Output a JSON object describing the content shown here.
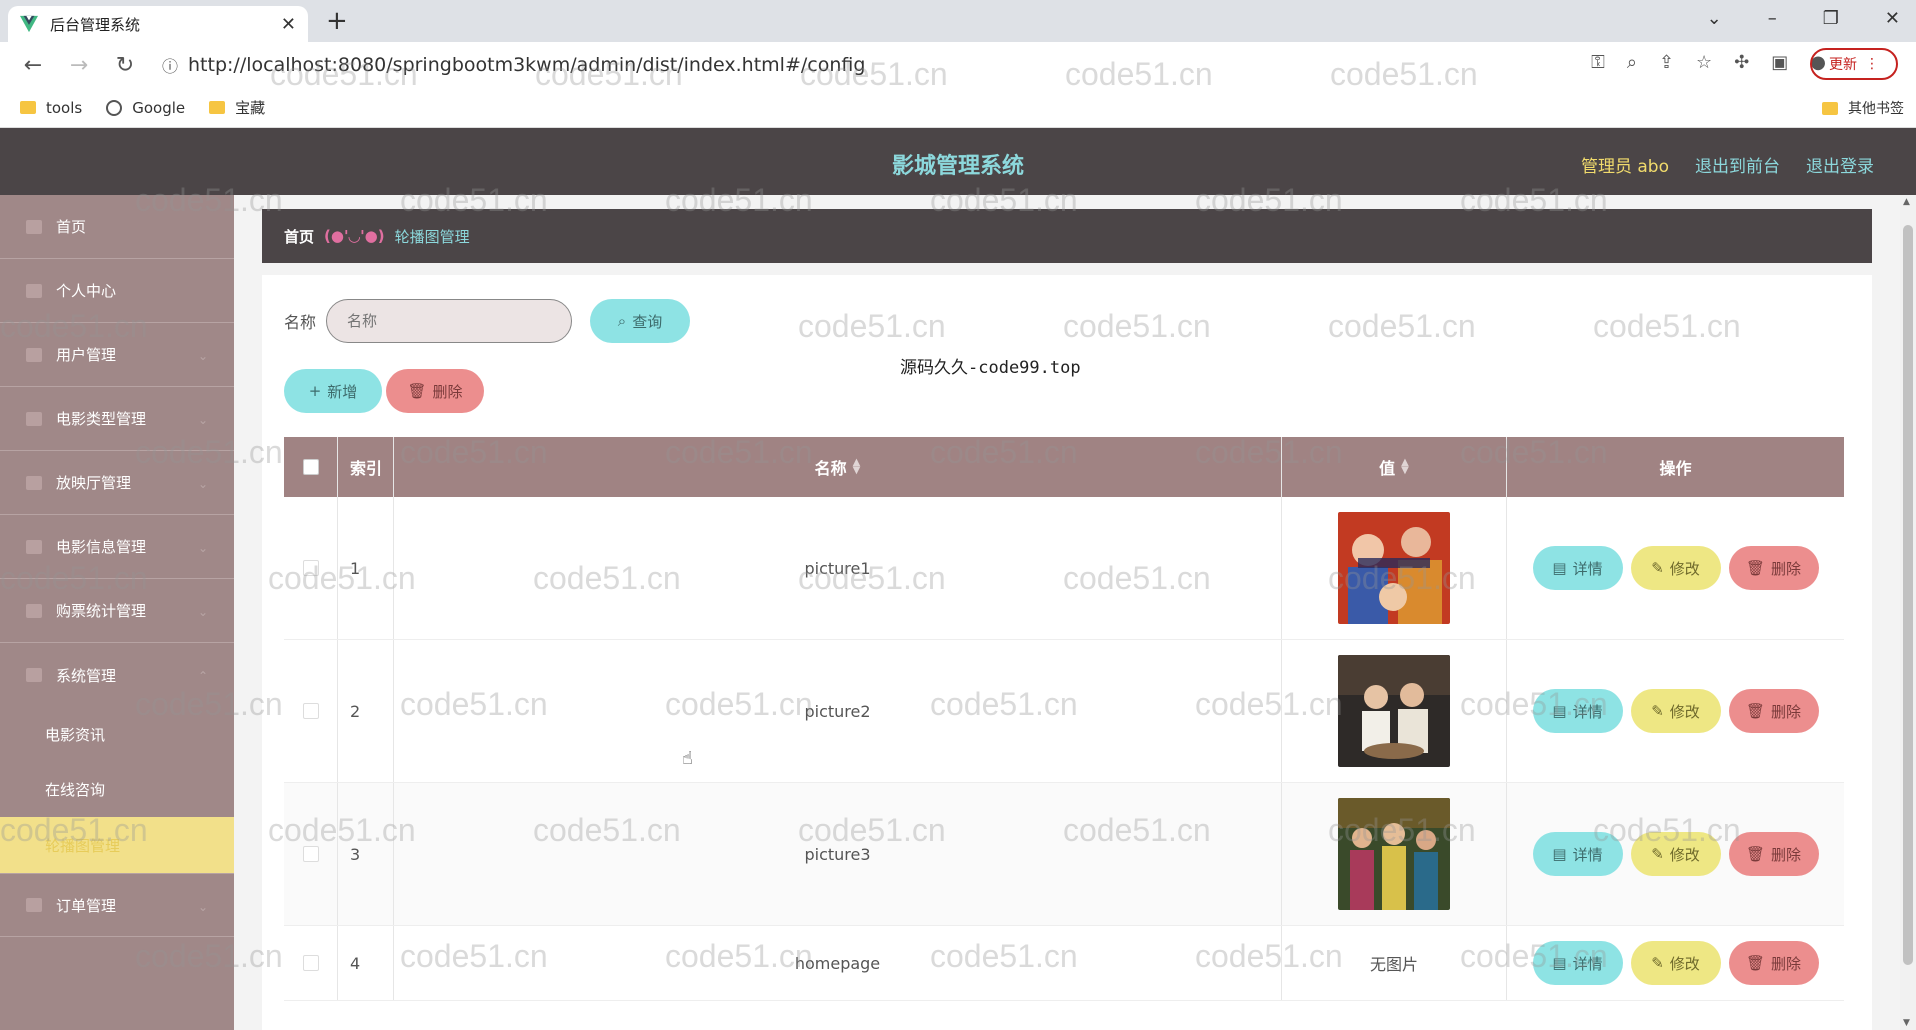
{
  "browser": {
    "tab_title": "后台管理系统",
    "url": "http://localhost:8080/springbootm3kwm/admin/dist/index.html#/config",
    "update_label": "更新",
    "bookmarks": [
      "tools",
      "Google",
      "宝藏"
    ],
    "other_bookmarks": "其他书签"
  },
  "header": {
    "title": "影城管理系统",
    "admin": "管理员 abo",
    "front": "退出到前台",
    "logout": "退出登录"
  },
  "sidebar": {
    "items": [
      {
        "label": "首页"
      },
      {
        "label": "个人中心"
      },
      {
        "label": "用户管理"
      },
      {
        "label": "电影类型管理"
      },
      {
        "label": "放映厅管理"
      },
      {
        "label": "电影信息管理"
      },
      {
        "label": "购票统计管理"
      },
      {
        "label": "系统管理"
      }
    ],
    "sub_items": [
      {
        "label": "电影资讯"
      },
      {
        "label": "在线咨询"
      },
      {
        "label": "轮播图管理"
      }
    ],
    "last": "订单管理"
  },
  "breadcrumb": {
    "home": "首页",
    "face": "(●'◡'●)",
    "current": "轮播图管理"
  },
  "search": {
    "label": "名称",
    "placeholder": "名称",
    "query_label": "查询"
  },
  "actions": {
    "add_label": "新增",
    "delete_label": "删除"
  },
  "table": {
    "headers": {
      "index": "索引",
      "name": "名称",
      "value": "值",
      "ops": "操作"
    },
    "overlay_text": "源码久久-code99.top",
    "rows": [
      {
        "index": "1",
        "name": "picture1",
        "value": ""
      },
      {
        "index": "2",
        "name": "picture2",
        "value": ""
      },
      {
        "index": "3",
        "name": "picture3",
        "value": ""
      },
      {
        "index": "4",
        "name": "homepage",
        "value": "无图片"
      }
    ],
    "op_labels": {
      "detail": "详情",
      "edit": "修改",
      "delete": "删除"
    }
  },
  "watermark": "code51.cn"
}
